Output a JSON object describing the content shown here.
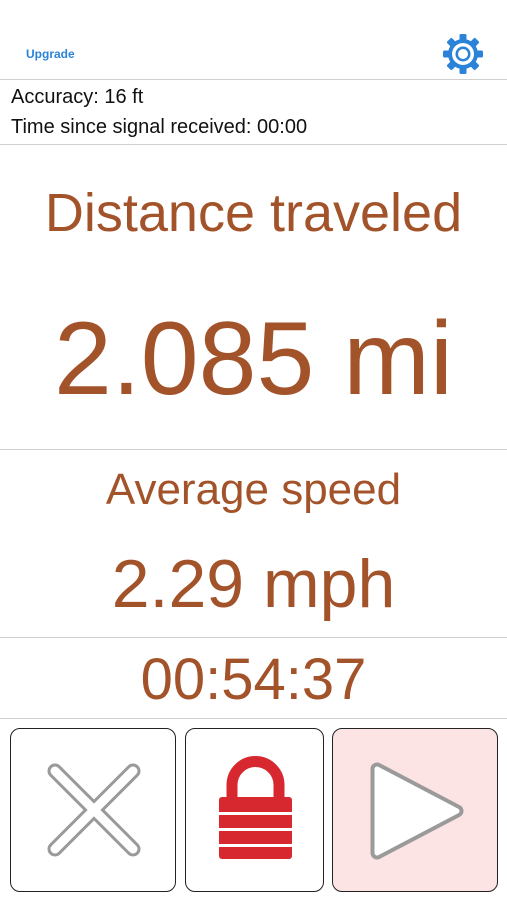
{
  "header": {
    "upgrade_label": "Upgrade",
    "settings_icon": "gear-icon",
    "accent_color": "#2a83d8"
  },
  "status": {
    "accuracy": "Accuracy: 16 ft",
    "time_since_signal": "Time since signal received: 00:00"
  },
  "distance": {
    "label": "Distance traveled",
    "value": "2.085 mi"
  },
  "speed": {
    "label": "Average speed",
    "value": "2.29 mph"
  },
  "elapsed_time": "00:54:37",
  "controls": {
    "cancel_icon": "close-icon",
    "lock_icon": "lock-icon",
    "play_icon": "play-icon",
    "lock_color": "#d8282f",
    "play_background": "#fde4e4"
  },
  "text_color": "#a3532a"
}
